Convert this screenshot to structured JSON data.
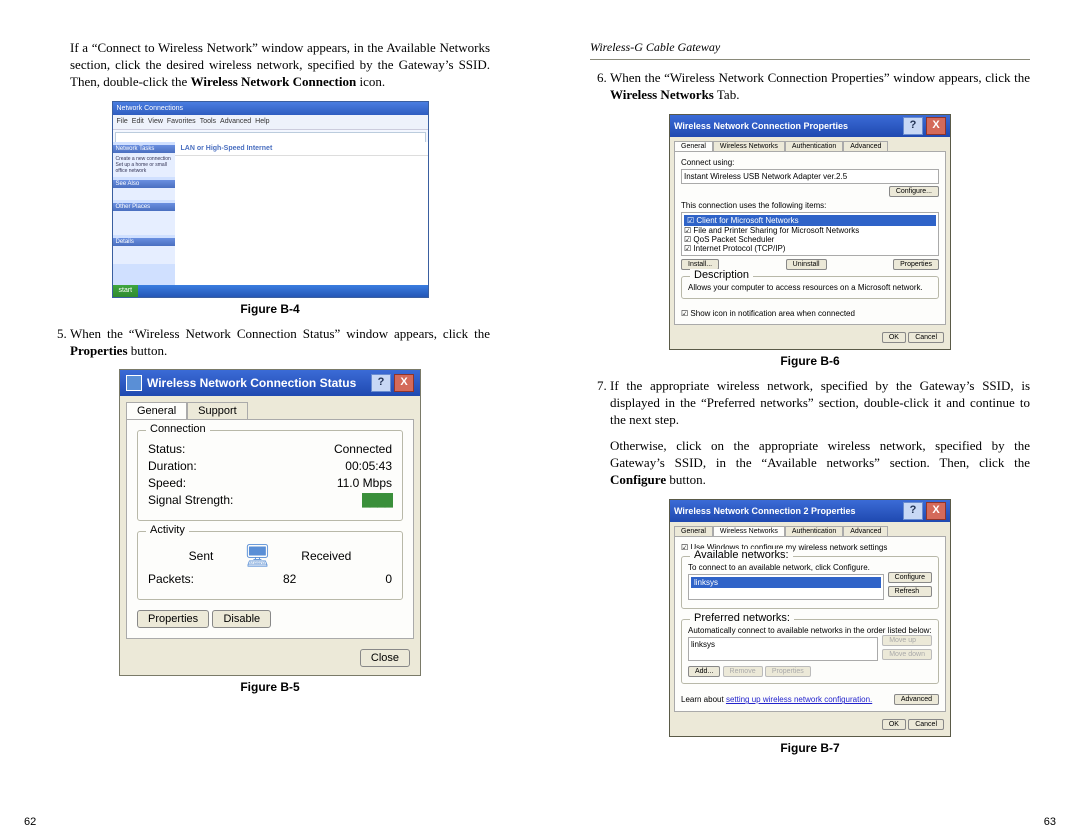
{
  "header": {
    "title": "Wireless-G Cable Gateway"
  },
  "left": {
    "para1": "If a “Connect to Wireless Network” window appears, in the Available Networks section, click the desired wireless network, specified by the Gateway’s SSID. Then, double-click the ",
    "para1_bold": "Wireless Network Connection",
    "para1_tail": " icon.",
    "fig4cap": "Figure B-4",
    "step5_a": "When the “Wireless Network Connection Status” window appears, click the ",
    "step5_bold": "Properties",
    "step5_c": " button.",
    "fig5cap": "Figure B-5",
    "pagenum": "62"
  },
  "right": {
    "step6_a": "When the “Wireless Network Connection Properties” window appears, click the ",
    "step6_bold": "Wireless Networks",
    "step6_c": " Tab.",
    "fig6cap": "Figure B-6",
    "step7_a": "If the appropriate wireless network, specified by the Gateway’s SSID, is displayed in the “Preferred networks” section, double-click it and continue to the next step.",
    "step7_b": "Otherwise, click on the appropriate wireless network, specified by the Gateway’s SSID, in the “Available networks” section. Then, click the ",
    "step7_bold": "Configure",
    "step7_c": " button.",
    "fig7cap": "Figure B-7",
    "pagenum": "63"
  },
  "figB4": {
    "title": "Network Connections",
    "menu": [
      "File",
      "Edit",
      "View",
      "Favorites",
      "Tools",
      "Advanced",
      "Help"
    ],
    "sidebar_hdrs": [
      "Network Tasks",
      "See Also",
      "Other Places",
      "Details"
    ],
    "sidebar_tasks": [
      "Create a new connection",
      "Set up a home or small office network"
    ],
    "section": "LAN or High-Speed Internet",
    "start": "start"
  },
  "figB5": {
    "title": "Wireless Network Connection Status",
    "tabs": [
      "General",
      "Support"
    ],
    "conn_legend": "Connection",
    "rows": {
      "status_l": "Status:",
      "status_v": "Connected",
      "dur_l": "Duration:",
      "dur_v": "00:05:43",
      "speed_l": "Speed:",
      "speed_v": "11.0 Mbps",
      "signal_l": "Signal Strength:",
      "signal_v": "████"
    },
    "act_legend": "Activity",
    "sent": "Sent",
    "recv": "Received",
    "packets_l": "Packets:",
    "packets_sent": "82",
    "packets_recv": "0",
    "btn_prop": "Properties",
    "btn_dis": "Disable",
    "btn_close": "Close"
  },
  "figB6": {
    "title": "Wireless Network Connection Properties",
    "tabs": [
      "General",
      "Wireless Networks",
      "Authentication",
      "Advanced"
    ],
    "connect_using": "Connect using:",
    "adapter": "Instant Wireless USB Network Adapter ver.2.5",
    "configure": "Configure...",
    "uses": "This connection uses the following items:",
    "items": [
      "Client for Microsoft Networks",
      "File and Printer Sharing for Microsoft Networks",
      "QoS Packet Scheduler",
      "Internet Protocol (TCP/IP)"
    ],
    "install": "Install...",
    "uninstall": "Uninstall",
    "props": "Properties",
    "desc": "Description",
    "desc_text": "Allows your computer to access resources on a Microsoft network.",
    "showicon": "Show icon in notification area when connected",
    "ok": "OK",
    "cancel": "Cancel"
  },
  "figB7": {
    "title": "Wireless Network Connection 2 Properties",
    "tabs": [
      "General",
      "Wireless Networks",
      "Authentication",
      "Advanced"
    ],
    "usewin": "Use Windows to configure my wireless network settings",
    "avail": "Available networks:",
    "avail_txt": "To connect to an available network, click Configure.",
    "net": "linksys",
    "configure": "Configure",
    "refresh": "Refresh",
    "pref": "Preferred networks:",
    "pref_txt": "Automatically connect to available networks in the order listed below:",
    "add": "Add...",
    "remove": "Remove",
    "props": "Properties",
    "moveup": "Move up",
    "movedn": "Move down",
    "learn": "Learn about ",
    "learn2": "setting up wireless network configuration.",
    "advanced": "Advanced",
    "ok": "OK",
    "cancel": "Cancel"
  }
}
